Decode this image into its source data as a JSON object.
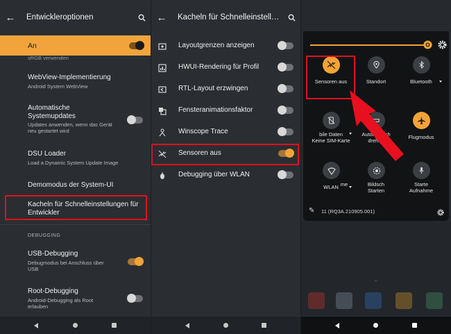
{
  "panel1": {
    "title": "Entwickleroptionen",
    "master": {
      "label": "An",
      "enabled": true
    },
    "cut_subtitle": "sRGB verwenden",
    "items": [
      {
        "title": "WebView-Implementierung",
        "subtitle": "Android System WebView"
      },
      {
        "title": "Automatische Systemupdates",
        "subtitle": "Updates anwenden, wenn das Gerät neu gestartet wird",
        "toggle": false
      },
      {
        "title": "DSU Loader",
        "subtitle": "Load a Dynamic System Update Image"
      },
      {
        "title": "Demomodus der System-UI"
      },
      {
        "title": "Kacheln für Schnelleinstellungen für Entwickler",
        "highlighted": true
      }
    ],
    "section_header": "DEBUGGING",
    "debug_items": [
      {
        "title": "USB-Debugging",
        "subtitle": "Debugmodus bei Anschluss über USB",
        "toggle": true
      },
      {
        "title": "Root-Debugging",
        "subtitle": "Android-Debugging als Root erlauben",
        "toggle": false
      }
    ]
  },
  "panel2": {
    "title": "Kacheln für Schnelleinstell…",
    "items": [
      {
        "icon": "layout-bounds-icon",
        "label": "Layoutgrenzen anzeigen",
        "toggle": false
      },
      {
        "icon": "hwui-profile-icon",
        "label": "HWUI-Rendering für Profil",
        "toggle": false
      },
      {
        "icon": "rtl-layout-icon",
        "label": "RTL-Layout erzwingen",
        "toggle": false
      },
      {
        "icon": "window-animation-icon",
        "label": "Fensteranimationsfaktor",
        "toggle": false
      },
      {
        "icon": "winscope-icon",
        "label": "Winscope Trace",
        "toggle": false
      },
      {
        "icon": "sensors-off-icon",
        "label": "Sensoren aus",
        "toggle": true,
        "highlighted": true
      },
      {
        "icon": "wireless-debug-icon",
        "label": "Debugging über WLAN",
        "toggle": false
      }
    ]
  },
  "panel3": {
    "brightness_level": 0.96,
    "tiles": [
      {
        "label": "Sensoren aus",
        "icon": "sensors-off-icon",
        "active": true
      },
      {
        "label": "Standort",
        "icon": "location-icon",
        "active": false
      },
      {
        "label": "Bluetooth",
        "icon": "bluetooth-icon",
        "active": false,
        "dropdown": true
      },
      {
        "label_line1": "bile Daten",
        "label_line2": "Keine SIM-Karte",
        "icon": "mobile-data-icon",
        "active": false,
        "dropdown": true
      },
      {
        "label_line1": "Automatisch",
        "label_line2": "drehen",
        "icon": "auto-rotate-icon",
        "active": false
      },
      {
        "label": "Flugmodus",
        "icon": "airplane-icon",
        "active": true
      },
      {
        "label": "WLAN",
        "icon": "wifi-icon",
        "active": false,
        "dropdown": true
      },
      {
        "label_line1": "Bildsch",
        "label_line2": "Starten",
        "label_extra": "me",
        "icon": "screen-record-icon",
        "active": false
      },
      {
        "label_line1": "Starte",
        "label_line2": "Aufnahme",
        "icon": "mic-icon",
        "active": false
      }
    ],
    "build_number": "11 (RQ3A.210905.001)"
  },
  "colors": {
    "accent": "#f4a337",
    "highlight_box": "#e01020",
    "arrow": "#e8101e"
  }
}
